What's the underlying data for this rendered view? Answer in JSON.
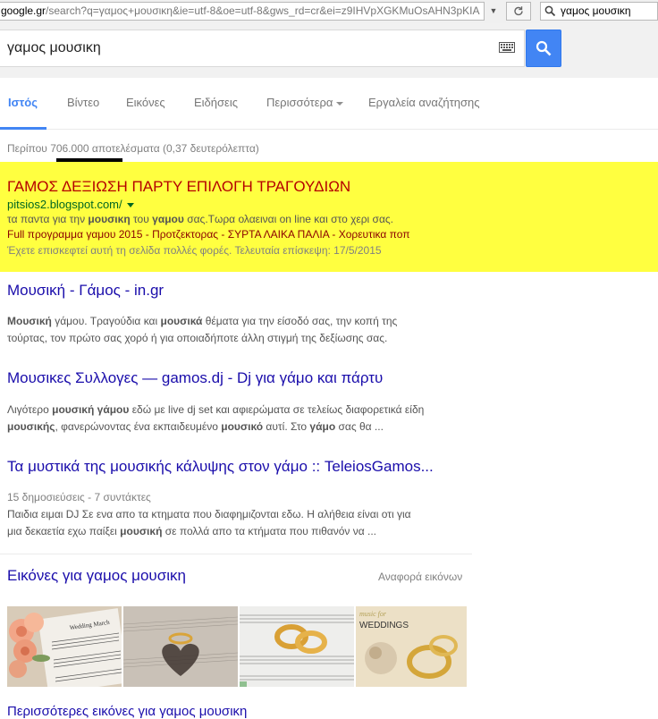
{
  "browser": {
    "url_domain": "google.gr",
    "url_rest": "/search?q=γαμος+μουσικη&ie=utf-8&oe=utf-8&gws_rd=cr&ei=z9IHVpXGKMuOsAHN3pKIA",
    "search_box_value": "γαμος μουσικη"
  },
  "search": {
    "query": "γαμος μουσικη"
  },
  "tabs": [
    "Ιστός",
    "Βίντεο",
    "Εικόνες",
    "Ειδήσεις",
    "Περισσότερα",
    "Εργαλεία αναζήτησης"
  ],
  "stats": "Περίπου 706.000 αποτελέσματα (0,37 δευτερόλεπτα)",
  "highlight_result": {
    "title": "ΓΑΜΟΣ ΔΕΞΙΩΣΗ ΠΑΡΤΥ ΕΠΙΛΟΓΗ ΤΡΑΓΟΥΔΙΩΝ",
    "url": "pitsios2.blogspot.com/",
    "snippet_pre": "τα παντα για την ",
    "snippet_b1": "μουσικη",
    "snippet_mid": " του ",
    "snippet_b2": "γαμου",
    "snippet_post": " σας.Τωρα ολαειναι on line και στο χερι σας.",
    "sitelinks": "Full προγραμμα γαμου 2015 - Προτζεκτορας - ΣΥΡΤΑ ΛΑΙΚΑ ΠΑΛΙΑ - Χορευτικα ποπ",
    "visited": "Έχετε επισκεφτεί αυτή τη σελίδα πολλές φορές. Τελευταία επίσκεψη: 17/5/2015"
  },
  "results": [
    {
      "title": "Μουσική - Γάμος - in.gr",
      "line1_b": "Μουσική",
      "line1": " γάμου. Τραγούδια και ",
      "line1_b2": "μουσικά",
      "line1_post": " θέματα για την είσοδό σας, την κοπή της",
      "line2": "τούρτας, τον πρώτο σας χορό ή για οποιαδήποτε άλλη στιγμή της δεξίωσης σας."
    },
    {
      "title": "Μουσικες Συλλογες — gamos.dj - Dj για γάμο και πάρτυ",
      "line1_pre": "Λιγότερο ",
      "line1_b": "μουσική γάμου",
      "line1_post": " εδώ με live dj set και αφιερώματα σε τελείως διαφορετικά είδη",
      "line2_b": "μουσικής",
      "line2_mid": ", φανερώνοντας ένα εκπαιδευμένο ",
      "line2_b2": "μουσικό",
      "line2_mid2": " αυτί. Στο ",
      "line2_b3": "γάμο",
      "line2_post": " σας θα ..."
    },
    {
      "title": "Τα μυστικά της μουσικής κάλυψης στον γάμο :: TeleiosGamos...",
      "meta": "15 δημοσιεύσεις - 7 συντάκτες",
      "line1": "Παιδια ειμαι DJ Σε ενα απο τα κτηματα που διαφημιζονται εδω. Η αλήθεια είναι οτι για",
      "line2_pre": "μια δεκαετία εχω παίξει ",
      "line2_b": "μουσική",
      "line2_post": " σε πολλά απο τα κτήματα που πιθανόν να ..."
    }
  ],
  "images": {
    "heading": "Εικόνες για γαμος μουσικη",
    "report": "Αναφορά εικόνων",
    "thumb1_text": "Wedding March",
    "thumb4_text1": "music for",
    "thumb4_text2": "WEDDINGS",
    "more": "Περισσότερες εικόνες για γαμος μουσικη"
  },
  "colors": {
    "link": "#1a0dab",
    "highlight": "#ffff40",
    "accent": "#4285f4",
    "url_green": "#006621"
  }
}
